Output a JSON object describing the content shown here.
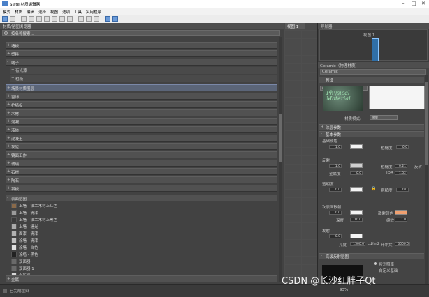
{
  "window": {
    "title": "Slate 材质编辑器"
  },
  "menu": [
    "模式",
    "材质",
    "编辑",
    "选择",
    "视图",
    "选项",
    "工具",
    "实用程序"
  ],
  "browser": {
    "title": "材质/贴图浏览器",
    "search_placeholder": "按名称搜索...",
    "top_categories": [
      "墙板",
      "塑料",
      "端子"
    ],
    "sub_items": [
      "有光漆",
      "粗糙"
    ],
    "selected_category": "场景材质图层",
    "categories": [
      "窗饰",
      "护墙板",
      "木材",
      "混凝",
      "液体",
      "混凝土",
      "灰泥",
      "镜面工作",
      "玻璃",
      "石材",
      "陶石",
      "铝板"
    ],
    "scene_section": "表面贴图",
    "materials": [
      "上墙 - 法兰木材上红色",
      "上墙 - 清漆",
      "上墙 - 法兰木材上黑色",
      "上墙 - 墙光",
      "面漆 - 清漆",
      "涂墙 - 清漆",
      "涂墙 - 白色",
      "涂墙 - 黑色",
      "双面器",
      "双面器 1",
      "白新墙"
    ],
    "bottom_category": "金属"
  },
  "view": {
    "tab": "视图 1"
  },
  "navigator": {
    "title": "导航器",
    "node_label": "视图 1"
  },
  "params": {
    "header": "Ceramic（物理材质）",
    "name": "Ceramic",
    "presets_label": "预设",
    "preset_value": "(选择预设)...",
    "preview_text": "Physical Material",
    "mode_label": "材质模式:",
    "mode_value": "简单",
    "rollout_coating": "涂层参数",
    "rollout_basic": "基本参数",
    "base_color": "基础颜色",
    "val_1_0": "1.0",
    "val_0_0": "0.0",
    "roughness": "粗糙度",
    "reflections": "反射",
    "val_1_0b": "1.0",
    "val_0_21": "0.21",
    "ior_val": "1.52",
    "metalness": "金属度",
    "ior": "IOR",
    "roughness_label2": "粗糙度",
    "inv": "反转",
    "transparency": "透明度",
    "subsurface": "次表面散射",
    "scatter_color": "散射颜色",
    "depth": "深度",
    "scale_label": "缩放",
    "val_10": "10.0",
    "val_1": "1.0",
    "emission": "发射",
    "luminance": "亮度",
    "kelvin": "开尔文",
    "val_1500": "1500.0",
    "unit_cdm2": "cd/m2",
    "val_6500": "6500.0",
    "rollout_special": "高级反射贴图",
    "radio_a": "按光照率",
    "radio_b": "自定义基础"
  },
  "status": {
    "text": "已完成渲染",
    "zoom": "93%"
  },
  "watermark": "CSDN @长沙红胖子Qt",
  "colors": {
    "accent": "#2f6fa8",
    "selection": "#5b6578",
    "scatter": "#f0a070"
  }
}
